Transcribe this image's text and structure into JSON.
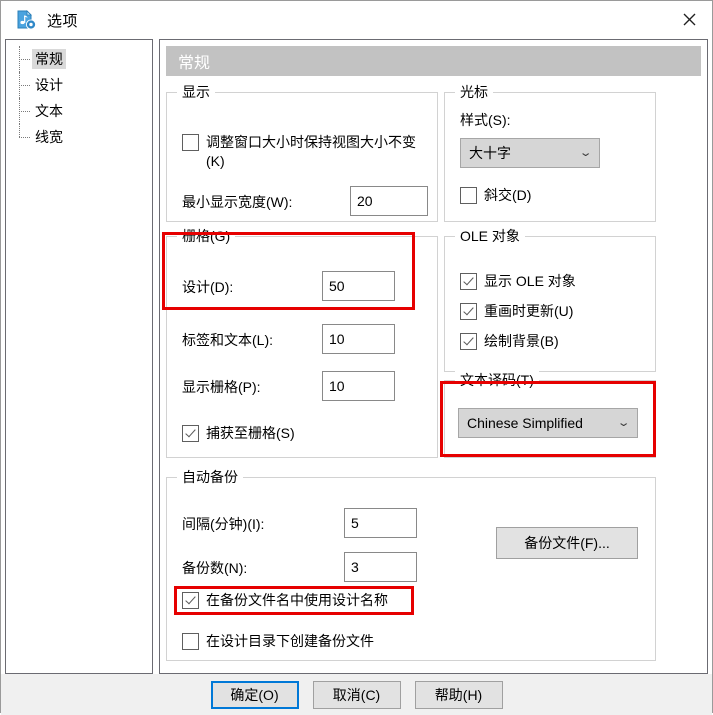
{
  "window": {
    "title": "选项",
    "icon": "options-document-icon",
    "close_icon": "close-icon"
  },
  "sidebar": {
    "items": [
      {
        "label": "常规",
        "selected": true
      },
      {
        "label": "设计",
        "selected": false
      },
      {
        "label": "文本",
        "selected": false
      },
      {
        "label": "线宽",
        "selected": false
      }
    ]
  },
  "panel": {
    "header": "常规",
    "groups": {
      "display": {
        "title": "显示",
        "keep_view_size_checkbox": "调整窗口大小时保持视图大小不变(K)",
        "keep_view_size_checked": false,
        "min_width_label": "最小显示宽度(W):",
        "min_width_value": "20"
      },
      "cursor": {
        "title": "光标",
        "style_label": "样式(S):",
        "style_value": "大十字",
        "oblique_checkbox": "斜交(D)",
        "oblique_checked": false
      },
      "grid": {
        "title": "栅格(G)",
        "design_label": "设计(D):",
        "design_value": "50",
        "label_text_label": "标签和文本(L):",
        "label_text_value": "10",
        "display_grid_label": "显示栅格(P):",
        "display_grid_value": "10",
        "snap_checkbox": "捕获至栅格(S)",
        "snap_checked": true
      },
      "ole": {
        "title": "OLE 对象",
        "show_ole_checkbox": "显示 OLE 对象",
        "show_ole_checked": true,
        "update_redraw_checkbox": "重画时更新(U)",
        "update_redraw_checked": true,
        "draw_background_checkbox": "绘制背景(B)",
        "draw_background_checked": true
      },
      "encoding": {
        "title": "文本译码(T)",
        "value": "Chinese Simplified"
      },
      "autobackup": {
        "title": "自动备份",
        "interval_label": "间隔(分钟)(I):",
        "interval_value": "5",
        "count_label": "备份数(N):",
        "count_value": "3",
        "use_design_name_checkbox": "在备份文件名中使用设计名称",
        "use_design_name_checked": true,
        "create_in_design_dir_checkbox": "在设计目录下创建备份文件",
        "create_in_design_dir_checked": false,
        "backup_files_button": "备份文件(F)..."
      }
    }
  },
  "footer": {
    "ok": "确定(O)",
    "cancel": "取消(C)",
    "help": "帮助(H)"
  },
  "colors": {
    "highlight_red": "#e60000",
    "header_gray": "#c2c2c2",
    "focus_blue": "#0078d7"
  }
}
